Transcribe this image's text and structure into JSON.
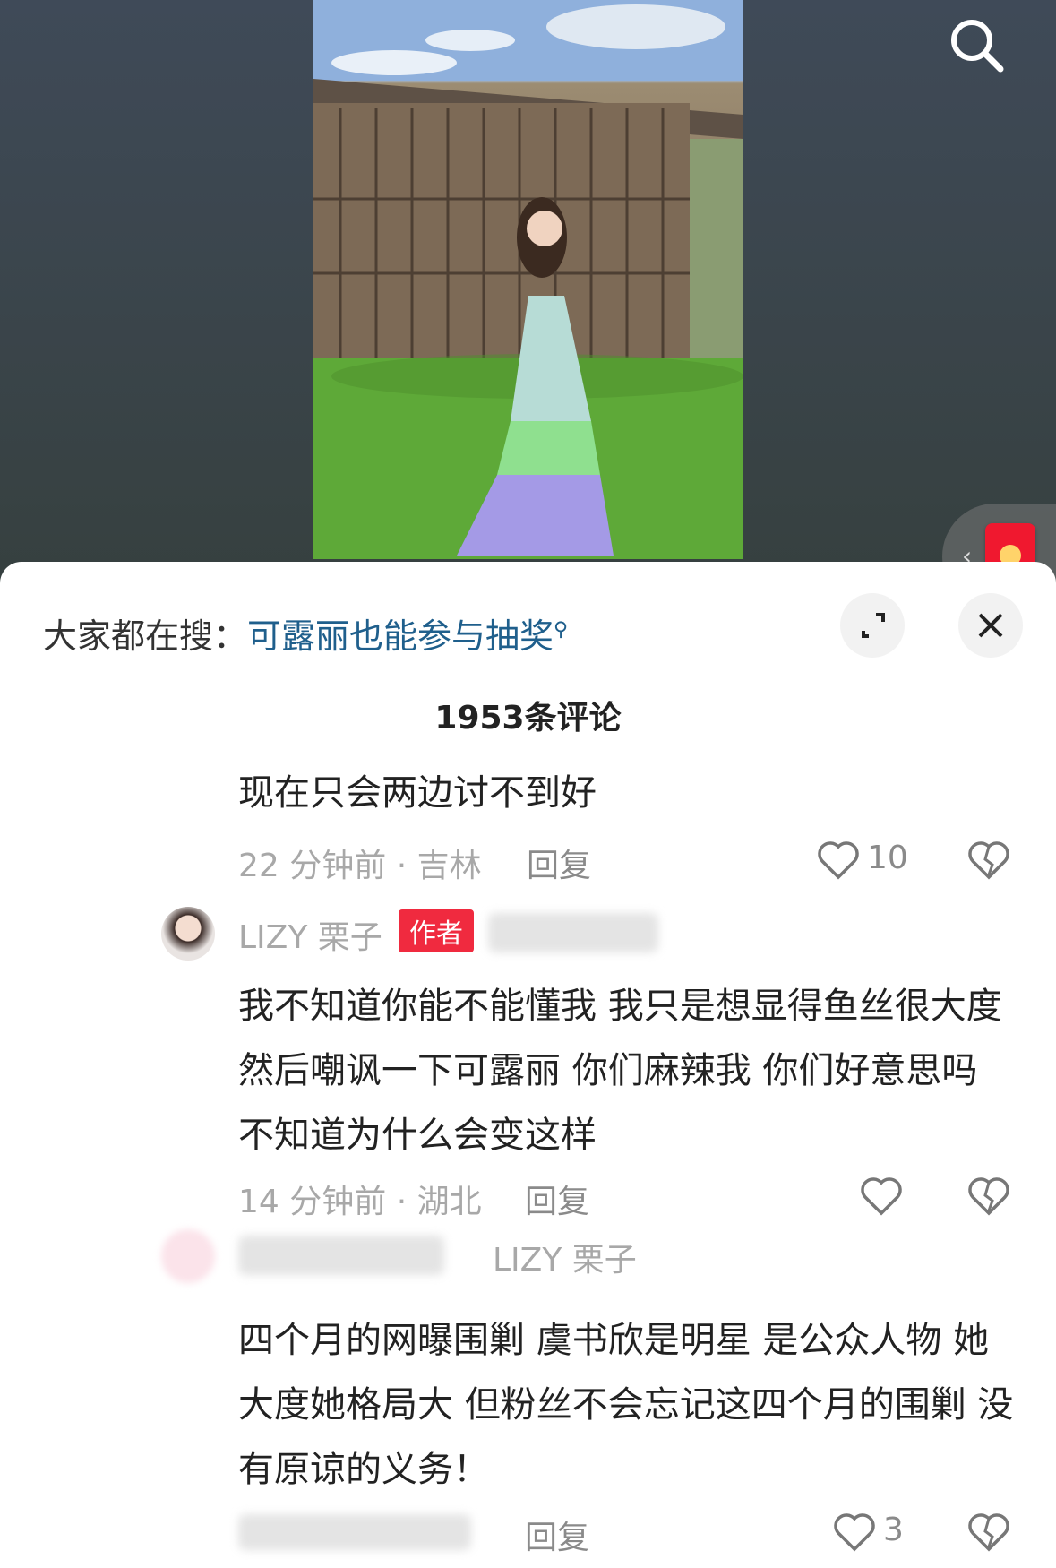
{
  "trending": {
    "prefix": "大家都在搜：",
    "keyword": "可露丽也能参与抽奖"
  },
  "comment_count": "1953条评论",
  "comments": [
    {
      "text": "现在只会两边讨不到好",
      "time_loc": "22 分钟前 · 吉林",
      "reply": "回复",
      "likes": "10"
    },
    {
      "author": "LIZY 栗子",
      "badge": "作者",
      "text": "我不知道你能不能懂我 我只是想显得鱼丝很大度 然后嘲讽一下可露丽 你们麻辣我 你们好意思吗 不知道为什么会变这样",
      "time_loc": "14 分钟前 · 湖北",
      "reply": "回复",
      "likes": ""
    },
    {
      "reply_to": "LIZY 栗子",
      "text": "四个月的网曝围剿 虞书欣是明星 是公众人物 她大度她格局大 但粉丝不会忘记这四个月的围剿 没有原谅的义务！",
      "reply": "回复",
      "likes": "3"
    }
  ],
  "colors": {
    "badge": "#f02a3f",
    "keyword": "#1f5f8c"
  }
}
